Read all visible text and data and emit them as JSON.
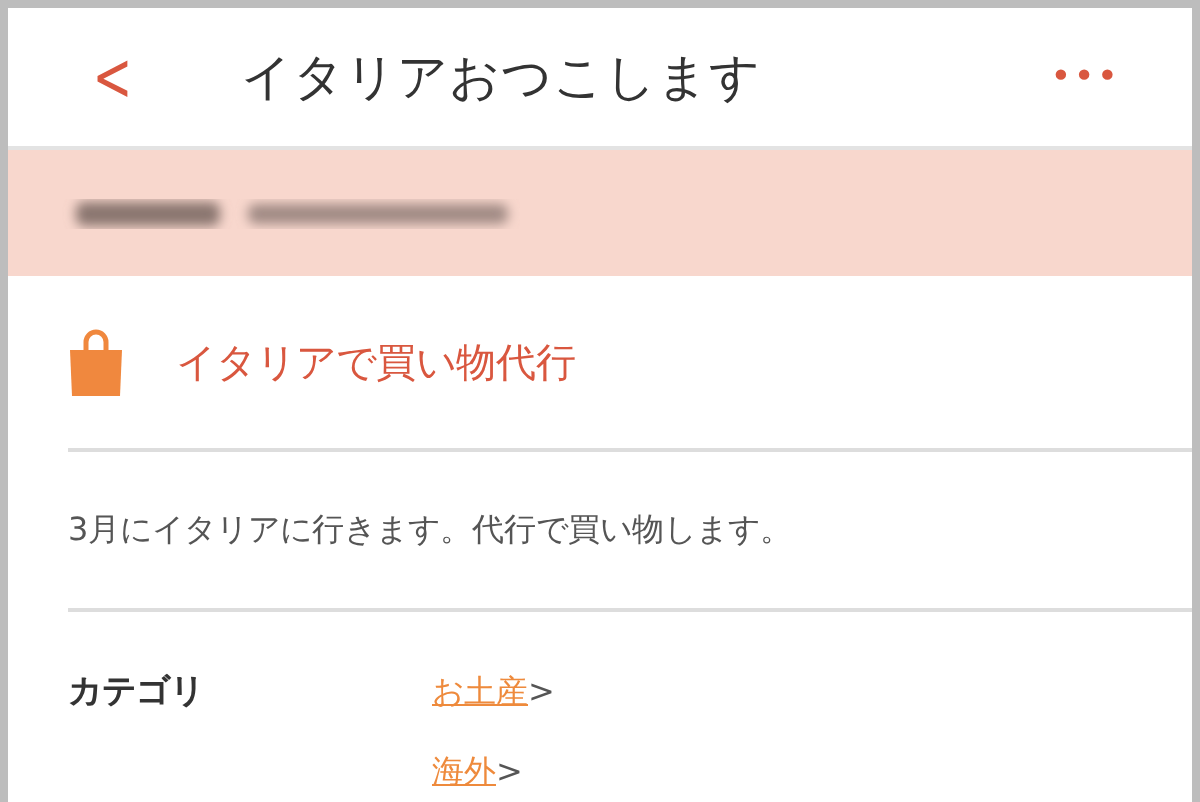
{
  "header": {
    "back": "<",
    "title": "イタリアおつこします",
    "more": "•••"
  },
  "notice": {
    "kind": "blurred"
  },
  "listing": {
    "title": "イタリアで買い物代行",
    "description": "3月にイタリアに行きます。代行で買い物します。"
  },
  "category": {
    "label": "カテゴリ",
    "links": [
      {
        "text": "お土産",
        "arrow": ">"
      },
      {
        "text": "海外",
        "arrow": ">"
      }
    ]
  }
}
